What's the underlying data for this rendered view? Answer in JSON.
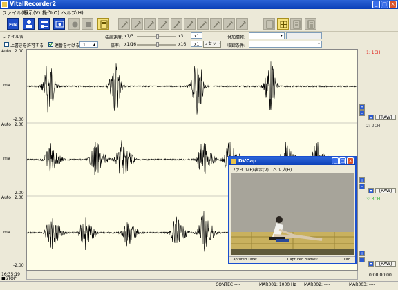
{
  "window": {
    "title": "VitalRecorder2",
    "min": "_",
    "max": "□",
    "close": "×"
  },
  "menu": [
    "ファイル(F)",
    "表示(V)",
    "操作(O)",
    "ヘルプ(H)"
  ],
  "toolbar": {
    "file_label": "File"
  },
  "controls": {
    "filename_label": "ファイル名",
    "overwrite_label": "上書きを許可する",
    "serial_label": "連番を付ける",
    "serial_value": "1",
    "draw_speed_label": "描画速度:",
    "draw_speed_min": "x1/3",
    "draw_speed_max": "x3",
    "draw_speed_value": "x1",
    "gain_label": "倍率:",
    "gain_min": "x1/16",
    "gain_max": "x16",
    "gain_value": "x1",
    "reset_label": "リセット",
    "attach_label": "付加情報:",
    "trigger_label": "収録条件:"
  },
  "channels": [
    {
      "mode": "Auto",
      "ymax": "2.00",
      "ymin": "-2.00",
      "unit": "mV",
      "label": "1: 1CH",
      "color": "#e0201a",
      "scale": "[RAW]"
    },
    {
      "mode": "Auto",
      "ymax": "2.00",
      "ymin": "-2.00",
      "unit": "mV",
      "label": "2: 2CH",
      "color": "#3b3b3b",
      "scale": "[RAW]"
    },
    {
      "mode": "Auto",
      "ymax": "2.00",
      "ymin": "-2.00",
      "unit": "mV",
      "label": "3: 3CH",
      "color": "#2bb02b",
      "scale": "[RAW]"
    }
  ],
  "time_right": "0:00:00:00",
  "subwindow": {
    "title": "DVCap",
    "menu": [
      "ファイル(F)",
      "表示(V)",
      "ヘルプ(H)"
    ],
    "status": [
      "Captured Time:",
      "Captured Frames:",
      "Dro"
    ]
  },
  "status": {
    "time": "16:35:19",
    "state": "■STOP",
    "contec": "CONTEC ----",
    "mar01": "MAR001: 1000 Hz",
    "mar02": "MAR002: ----",
    "mar03": "MAR003: ----"
  }
}
